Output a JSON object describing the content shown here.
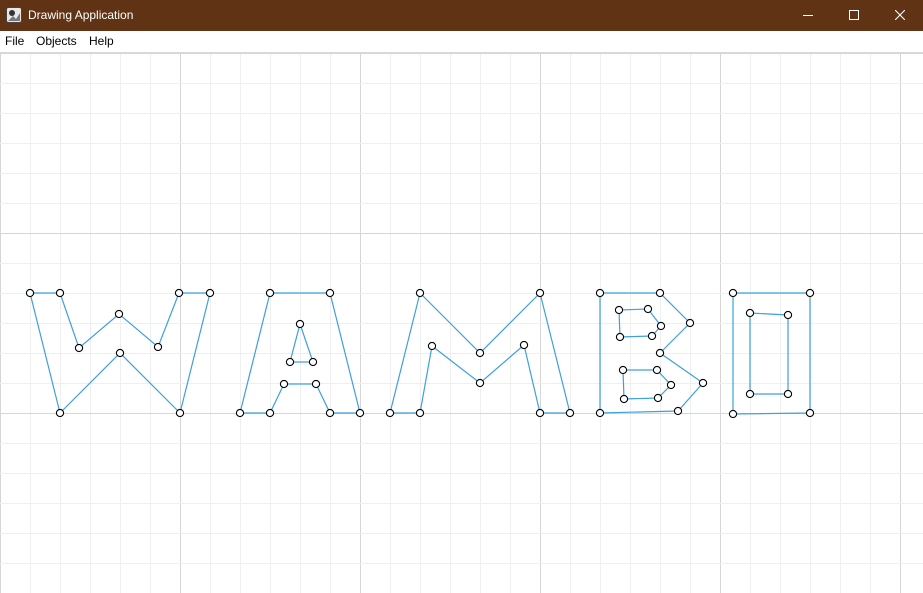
{
  "window": {
    "title": "Drawing Application",
    "titlebar_color": "#603314",
    "app_icon": "drawing-app-icon",
    "controls": [
      "minimize-icon",
      "maximize-icon",
      "close-icon"
    ]
  },
  "menubar": {
    "items": [
      {
        "label": "File"
      },
      {
        "label": "Objects"
      },
      {
        "label": "Help"
      }
    ]
  },
  "canvas": {
    "background": "#ffffff",
    "grid_minor_color": "#efefef",
    "grid_major_color": "#d6d6d6",
    "stroke_color": "#3ea0dc",
    "vertex_fill": "#ffffff",
    "vertex_stroke": "#000000"
  }
}
